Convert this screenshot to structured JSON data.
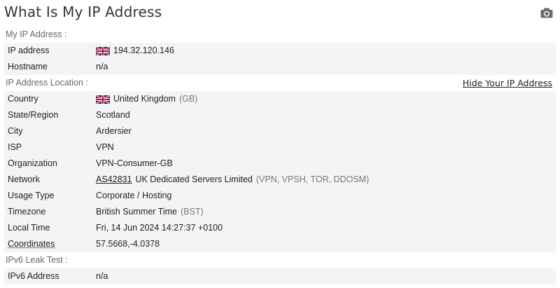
{
  "page": {
    "title": "What Is My IP Address"
  },
  "icons": {
    "camera": "camera-icon",
    "flag": "uk-flag-icon"
  },
  "sections": {
    "my_ip": {
      "heading": "My IP Address :",
      "rows": {
        "ip": {
          "label": "IP address",
          "value": "194.32.120.146"
        },
        "hostname": {
          "label": "Hostname",
          "value": "n/a"
        }
      }
    },
    "location": {
      "heading": "IP Address Location :",
      "hide_link": "Hide Your IP Address",
      "rows": {
        "country": {
          "label": "Country",
          "value": "United Kingdom",
          "extra": "(GB)"
        },
        "region": {
          "label": "State/Region",
          "value": "Scotland"
        },
        "city": {
          "label": "City",
          "value": "Ardersier"
        },
        "isp": {
          "label": "ISP",
          "value": "VPN"
        },
        "org": {
          "label": "Organization",
          "value": "VPN-Consumer-GB"
        },
        "network": {
          "label": "Network",
          "asn": "AS42831",
          "value": "UK Dedicated Servers Limited",
          "extra": "(VPN, VPSH, TOR, DDOSM)"
        },
        "usage": {
          "label": "Usage Type",
          "value": "Corporate / Hosting"
        },
        "timezone": {
          "label": "Timezone",
          "value": "British Summer Time",
          "extra": "(BST)"
        },
        "localtime": {
          "label": "Local Time",
          "value": "Fri, 14 Jun 2024 14:27:37 +0100"
        },
        "coords": {
          "label": "Coordinates",
          "value": "57.5668,-4.0378"
        }
      }
    },
    "ipv6": {
      "heading": "IPv6 Leak Test :",
      "rows": {
        "address": {
          "label": "IPv6 Address",
          "value": "n/a"
        }
      }
    }
  }
}
